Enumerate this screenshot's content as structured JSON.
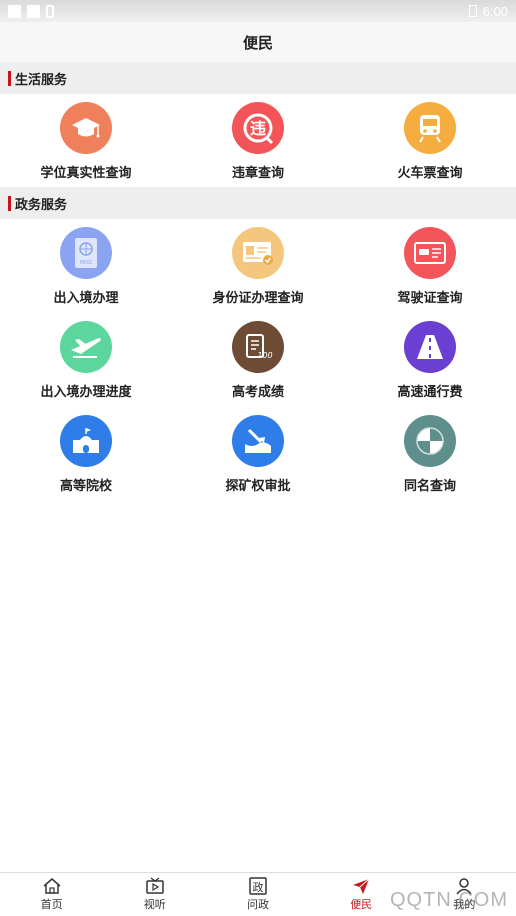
{
  "status_bar": {
    "time": "6:00"
  },
  "header": {
    "title": "便民"
  },
  "sections": [
    {
      "title": "生活服务",
      "items": [
        {
          "label": "学位真实性查询",
          "icon": "graduation-cap-icon",
          "color": "#f07f5c"
        },
        {
          "label": "违章查询",
          "icon": "violation-icon",
          "color": "#f25457"
        },
        {
          "label": "火车票查询",
          "icon": "train-icon",
          "color": "#f5ad3f"
        }
      ]
    },
    {
      "title": "政务服务",
      "items": [
        {
          "label": "出入境办理",
          "icon": "passport-icon",
          "color": "#8aa4f2"
        },
        {
          "label": "身份证办理查询",
          "icon": "id-card-icon",
          "color": "#f5c77e"
        },
        {
          "label": "驾驶证查询",
          "icon": "driver-license-icon",
          "color": "#f2555a"
        },
        {
          "label": "出入境办理进度",
          "icon": "airplane-icon",
          "color": "#5dd69e"
        },
        {
          "label": "高考成绩",
          "icon": "exam-score-icon",
          "color": "#6e4b35"
        },
        {
          "label": "高速通行费",
          "icon": "highway-icon",
          "color": "#6a3fd1"
        },
        {
          "label": "高等院校",
          "icon": "university-icon",
          "color": "#2f7de8"
        },
        {
          "label": "探矿权审批",
          "icon": "mining-icon",
          "color": "#2f7de8"
        },
        {
          "label": "同名查询",
          "icon": "same-name-icon",
          "color": "#5f8f8c"
        }
      ]
    }
  ],
  "tabs": [
    {
      "label": "首页",
      "icon": "home-icon"
    },
    {
      "label": "视听",
      "icon": "tv-icon"
    },
    {
      "label": "问政",
      "icon": "politics-icon"
    },
    {
      "label": "便民",
      "icon": "send-icon",
      "active": true
    },
    {
      "label": "我的",
      "icon": "user-icon"
    }
  ],
  "watermark": "QQTN.COM",
  "accent_color": "#c8161d"
}
